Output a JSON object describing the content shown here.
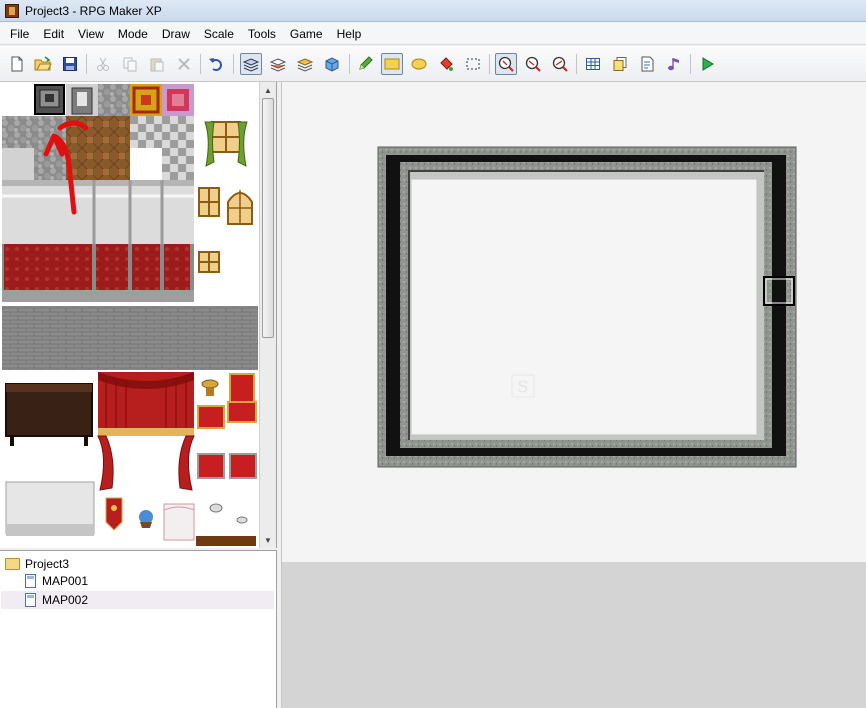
{
  "window": {
    "title": "Project3 - RPG Maker XP"
  },
  "menu": [
    "File",
    "Edit",
    "View",
    "Mode",
    "Draw",
    "Scale",
    "Tools",
    "Game",
    "Help"
  ],
  "toolbar": {
    "buttons": [
      {
        "name": "new-project-icon"
      },
      {
        "name": "open-project-icon"
      },
      {
        "name": "save-project-icon"
      },
      {
        "name": "cut-icon"
      },
      {
        "name": "copy-icon"
      },
      {
        "name": "paste-icon"
      },
      {
        "name": "delete-icon"
      },
      {
        "name": "undo-icon"
      },
      {
        "name": "layer1-icon"
      },
      {
        "name": "layer2-icon"
      },
      {
        "name": "layer3-icon"
      },
      {
        "name": "events-layer-icon"
      },
      {
        "name": "pencil-icon"
      },
      {
        "name": "rectangle-icon"
      },
      {
        "name": "ellipse-icon"
      },
      {
        "name": "fill-icon"
      },
      {
        "name": "select-icon"
      },
      {
        "name": "zoom-1x-icon"
      },
      {
        "name": "zoom-2x-icon"
      },
      {
        "name": "zoom-4x-icon"
      },
      {
        "name": "database-icon"
      },
      {
        "name": "materials-icon"
      },
      {
        "name": "script-editor-icon"
      },
      {
        "name": "sound-test-icon"
      },
      {
        "name": "playtest-icon"
      }
    ]
  },
  "map_tree": {
    "project": "Project3",
    "maps": [
      "MAP001",
      "MAP002"
    ],
    "selected": "MAP002"
  },
  "map_canvas": {
    "start_marker": "S"
  },
  "colors": {
    "annotation": "#e01010",
    "selection": "#f1ecf4"
  }
}
